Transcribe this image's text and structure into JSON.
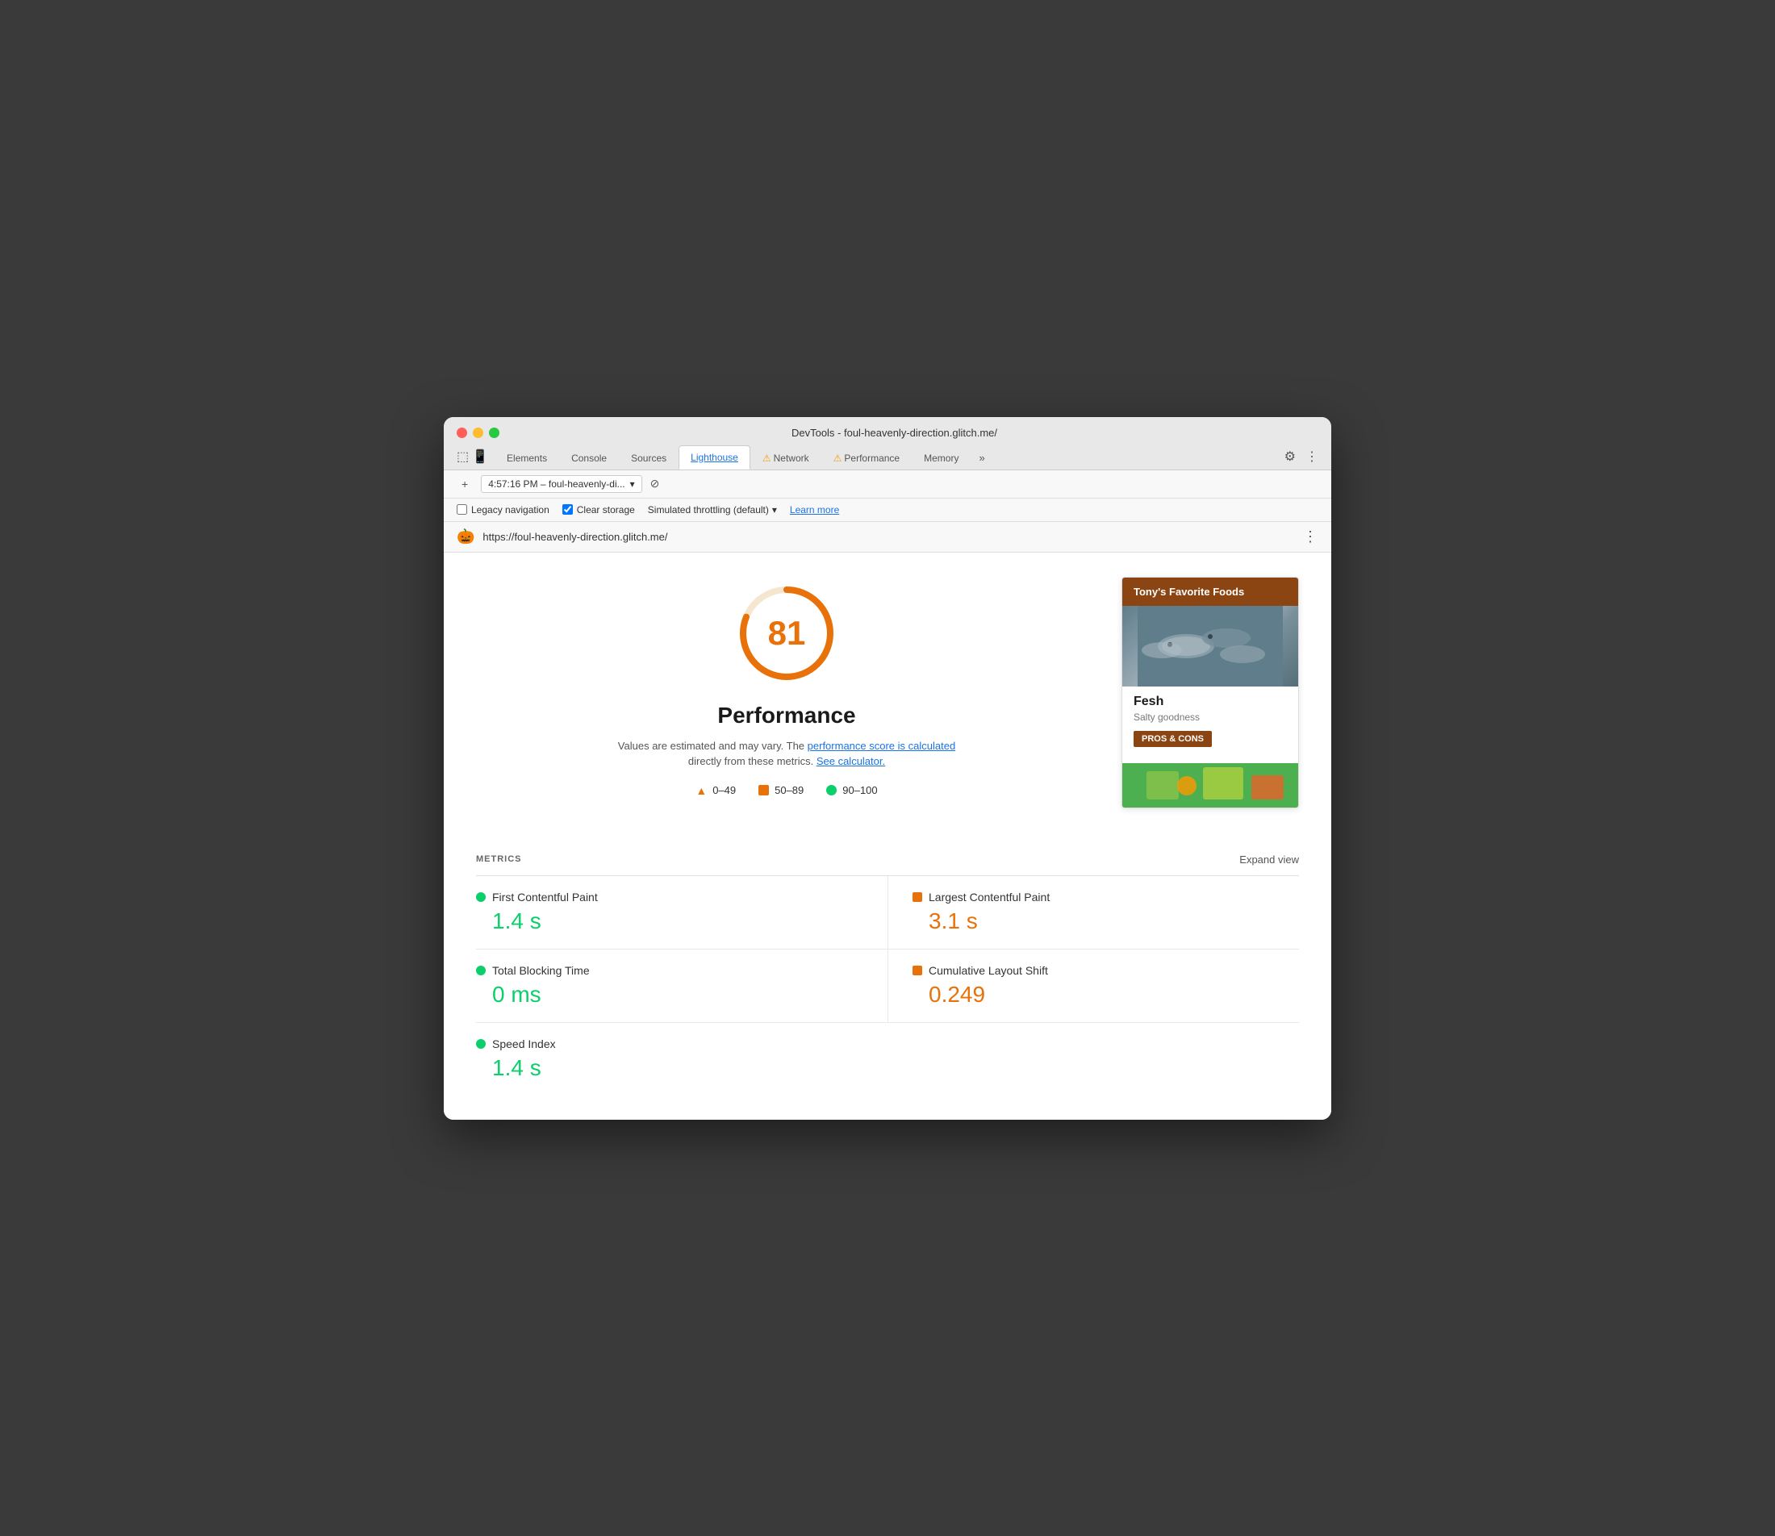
{
  "window": {
    "title": "DevTools - foul-heavenly-direction.glitch.me/"
  },
  "tabs": [
    {
      "label": "Elements",
      "active": false,
      "warning": false
    },
    {
      "label": "Console",
      "active": false,
      "warning": false
    },
    {
      "label": "Sources",
      "active": false,
      "warning": false
    },
    {
      "label": "Lighthouse",
      "active": true,
      "warning": false
    },
    {
      "label": "Network",
      "active": false,
      "warning": true
    },
    {
      "label": "Performance",
      "active": false,
      "warning": true
    },
    {
      "label": "Memory",
      "active": false,
      "warning": false
    }
  ],
  "toolbar": {
    "session_label": "4:57:16 PM – foul-heavenly-di..."
  },
  "options": {
    "legacy_navigation_label": "Legacy navigation",
    "legacy_navigation_checked": false,
    "clear_storage_label": "Clear storage",
    "clear_storage_checked": true,
    "throttling_label": "Simulated throttling (default)",
    "learn_more_label": "Learn more"
  },
  "url_bar": {
    "url": "https://foul-heavenly-direction.glitch.me/"
  },
  "score_section": {
    "score": "81",
    "title": "Performance",
    "description_text": "Values are estimated and may vary. The",
    "performance_score_link": "performance score is calculated",
    "mid_text": "directly from these metrics.",
    "calculator_link": "See calculator.",
    "legend": [
      {
        "range": "0–49",
        "type": "triangle",
        "color": "#e8710a"
      },
      {
        "range": "50–89",
        "type": "square",
        "color": "#e8710a"
      },
      {
        "range": "90–100",
        "type": "circle",
        "color": "#0cce6b"
      }
    ]
  },
  "site_preview": {
    "header": "Tony's Favorite Foods",
    "food_name": "Fesh",
    "tagline": "Salty goodness",
    "pros_cons_label": "PROS & CONS"
  },
  "metrics": {
    "section_label": "METRICS",
    "expand_label": "Expand view",
    "items": [
      {
        "name": "First Contentful Paint",
        "value": "1.4 s",
        "status": "green"
      },
      {
        "name": "Largest Contentful Paint",
        "value": "3.1 s",
        "status": "orange"
      },
      {
        "name": "Total Blocking Time",
        "value": "0 ms",
        "status": "green"
      },
      {
        "name": "Cumulative Layout Shift",
        "value": "0.249",
        "status": "orange"
      },
      {
        "name": "Speed Index",
        "value": "1.4 s",
        "status": "green"
      }
    ]
  }
}
